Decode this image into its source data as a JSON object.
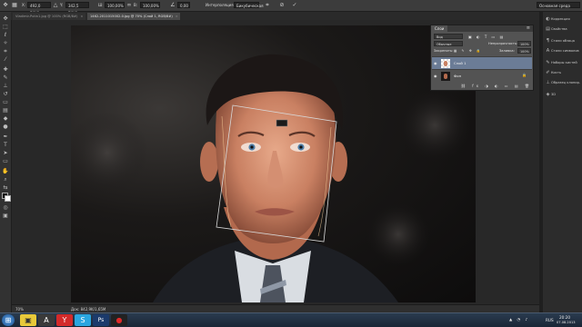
{
  "window": {
    "title": "Photoshop"
  },
  "options_bar": {
    "x_label": "X:",
    "x_value": "492,0 пикс",
    "y_label": "Y:",
    "y_value": "342,5 пикс",
    "w_label": "Ш:",
    "w_value": "100,00%",
    "h_label": "В:",
    "h_value": "100,00%",
    "angle_value": "0,00",
    "interpolation_label": "Интерполяция:",
    "interpolation_value": "Бикубическая",
    "workspace": "Основная среда"
  },
  "tabs": [
    {
      "label": "Vladimir-Putin1.jpg @ 100% (RGB/8#)",
      "active": false
    },
    {
      "label": "1462-2011015002-0.jpg @ 70% (Слой 1, RGB/8#)",
      "active": true
    }
  ],
  "status": {
    "zoom": "70%",
    "doc": "Док: 842,9K/1,65M"
  },
  "right_panels": [
    {
      "label": "Коррекция",
      "icon": "adjustments-icon"
    },
    {
      "label": "Свойства",
      "icon": "properties-icon"
    },
    {
      "label": "Стили абзаца",
      "icon": "paragraph-styles-icon"
    },
    {
      "label": "Стили символов",
      "icon": "character-styles-icon"
    },
    {
      "label": "Наборы кистей",
      "icon": "brush-presets-icon"
    },
    {
      "label": "Кисть",
      "icon": "brush-icon"
    },
    {
      "label": "Образец клонир.",
      "icon": "clone-source-icon"
    },
    {
      "label": "3D",
      "icon": "3d-icon"
    }
  ],
  "layers_panel": {
    "tab": "Слои",
    "filter_label": "Вид",
    "blend_mode": "Обычные",
    "opacity_label": "Непрозрачность:",
    "opacity_value": "100%",
    "lock_label": "Закрепить:",
    "fill_label": "Заливка:",
    "fill_value": "100%",
    "layers": [
      {
        "name": "Слой 1",
        "selected": true
      },
      {
        "name": "Фон",
        "selected": false
      }
    ]
  },
  "taskbar": {
    "language": "RUS",
    "time": "20:20",
    "date": "07.08.2013"
  }
}
